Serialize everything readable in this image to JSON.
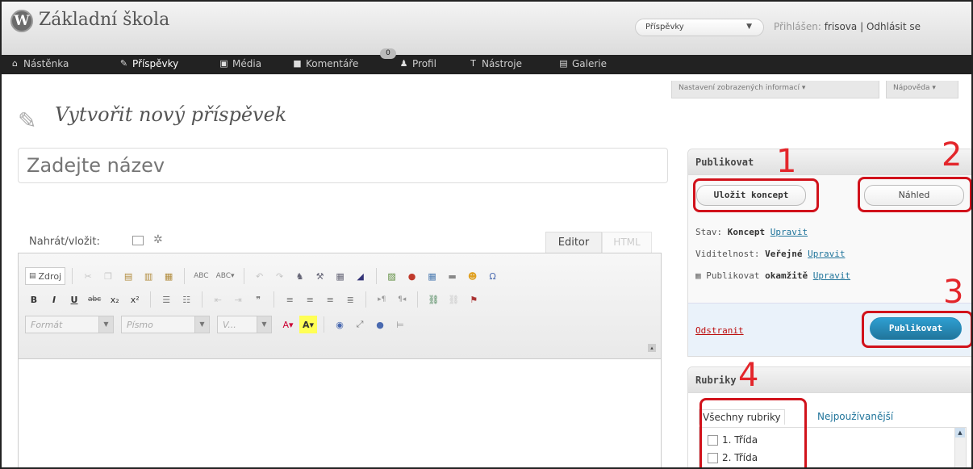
{
  "header": {
    "logo_glyph": "W",
    "site_title": "Základní škola",
    "favorites_label": "Příspěvky",
    "favorites_arrow": "▼",
    "logged_in_prefix": "Přihlášen:",
    "username": "frisova",
    "separator": "|",
    "logout_label": "Odhlásit se"
  },
  "menu": {
    "items": [
      {
        "label": "Nástěnka",
        "icon": "home-icon",
        "glyph": "⌂"
      },
      {
        "label": "Příspěvky",
        "icon": "pin-icon",
        "glyph": "✎"
      },
      {
        "label": "Média",
        "icon": "media-icon",
        "glyph": "▣"
      },
      {
        "label": "Komentáře",
        "icon": "comment-icon",
        "glyph": "■"
      },
      {
        "label": "Profil",
        "icon": "users-icon",
        "glyph": "♟"
      },
      {
        "label": "Nástroje",
        "icon": "tools-icon",
        "glyph": "T"
      },
      {
        "label": "Galerie",
        "icon": "gallery-icon",
        "glyph": "▤"
      }
    ],
    "comment_count": "0"
  },
  "screen_options": {
    "options_label": "Nastavení zobrazených informací ▾",
    "help_label": "Nápověda ▾"
  },
  "page": {
    "title": "Vytvořit nový příspěvek"
  },
  "editor": {
    "title_placeholder": "Zadejte název",
    "upload_label": "Nahrát/vložit:",
    "tab_editor": "Editor",
    "tab_html": "HTML",
    "source_label": "Zdroj",
    "format_placeholder": "Formát",
    "font_placeholder": "Písmo",
    "size_placeholder": "V...",
    "bold": "B",
    "italic": "I",
    "underline": "U"
  },
  "publish_box": {
    "heading": "Publikovat",
    "save_draft": "Uložit koncept",
    "preview": "Náhled",
    "status_label": "Stav:",
    "status_value": "Koncept",
    "visibility_label": "Viditelnost:",
    "visibility_value": "Veřejné",
    "publish_label": "Publikovat",
    "publish_value": "okamžitě",
    "edit_link": "Upravit",
    "delete_link": "Odstranit",
    "publish_button": "Publikovat"
  },
  "categories_box": {
    "heading": "Rubriky",
    "tab_all": "Všechny rubriky",
    "tab_popular": "Nejpoužívanější",
    "items": [
      "1. Třída",
      "2. Třída"
    ]
  },
  "annotations": {
    "n1": "1",
    "n2": "2",
    "n3": "3",
    "n4": "4",
    "color": "#d1121b"
  }
}
